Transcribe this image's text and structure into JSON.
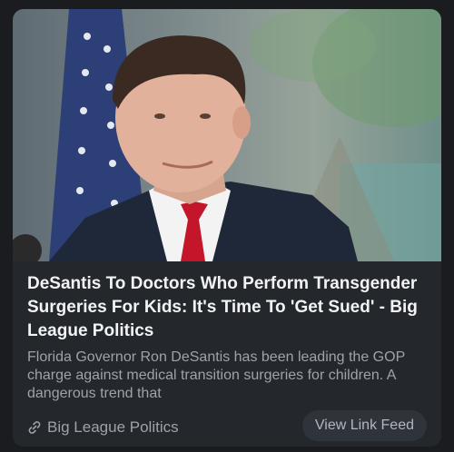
{
  "card": {
    "image": {
      "description": ""
    },
    "title": "DeSantis To Doctors Who Perform Transgender Surgeries For Kids: It's Time To 'Get Sued' - Big League Politics",
    "description": "Florida Governor Ron DeSantis has been leading the GOP charge against medical transition surgeries for children. A dangerous trend that",
    "source": {
      "icon": "link-icon",
      "name": "Big League Politics"
    },
    "action_label": "View Link Feed"
  },
  "colors": {
    "background": "#1a1c20",
    "card": "#24272c",
    "title": "#f2f3f5",
    "muted_text": "#9ea3aa",
    "button_bg": "#2f333a"
  }
}
